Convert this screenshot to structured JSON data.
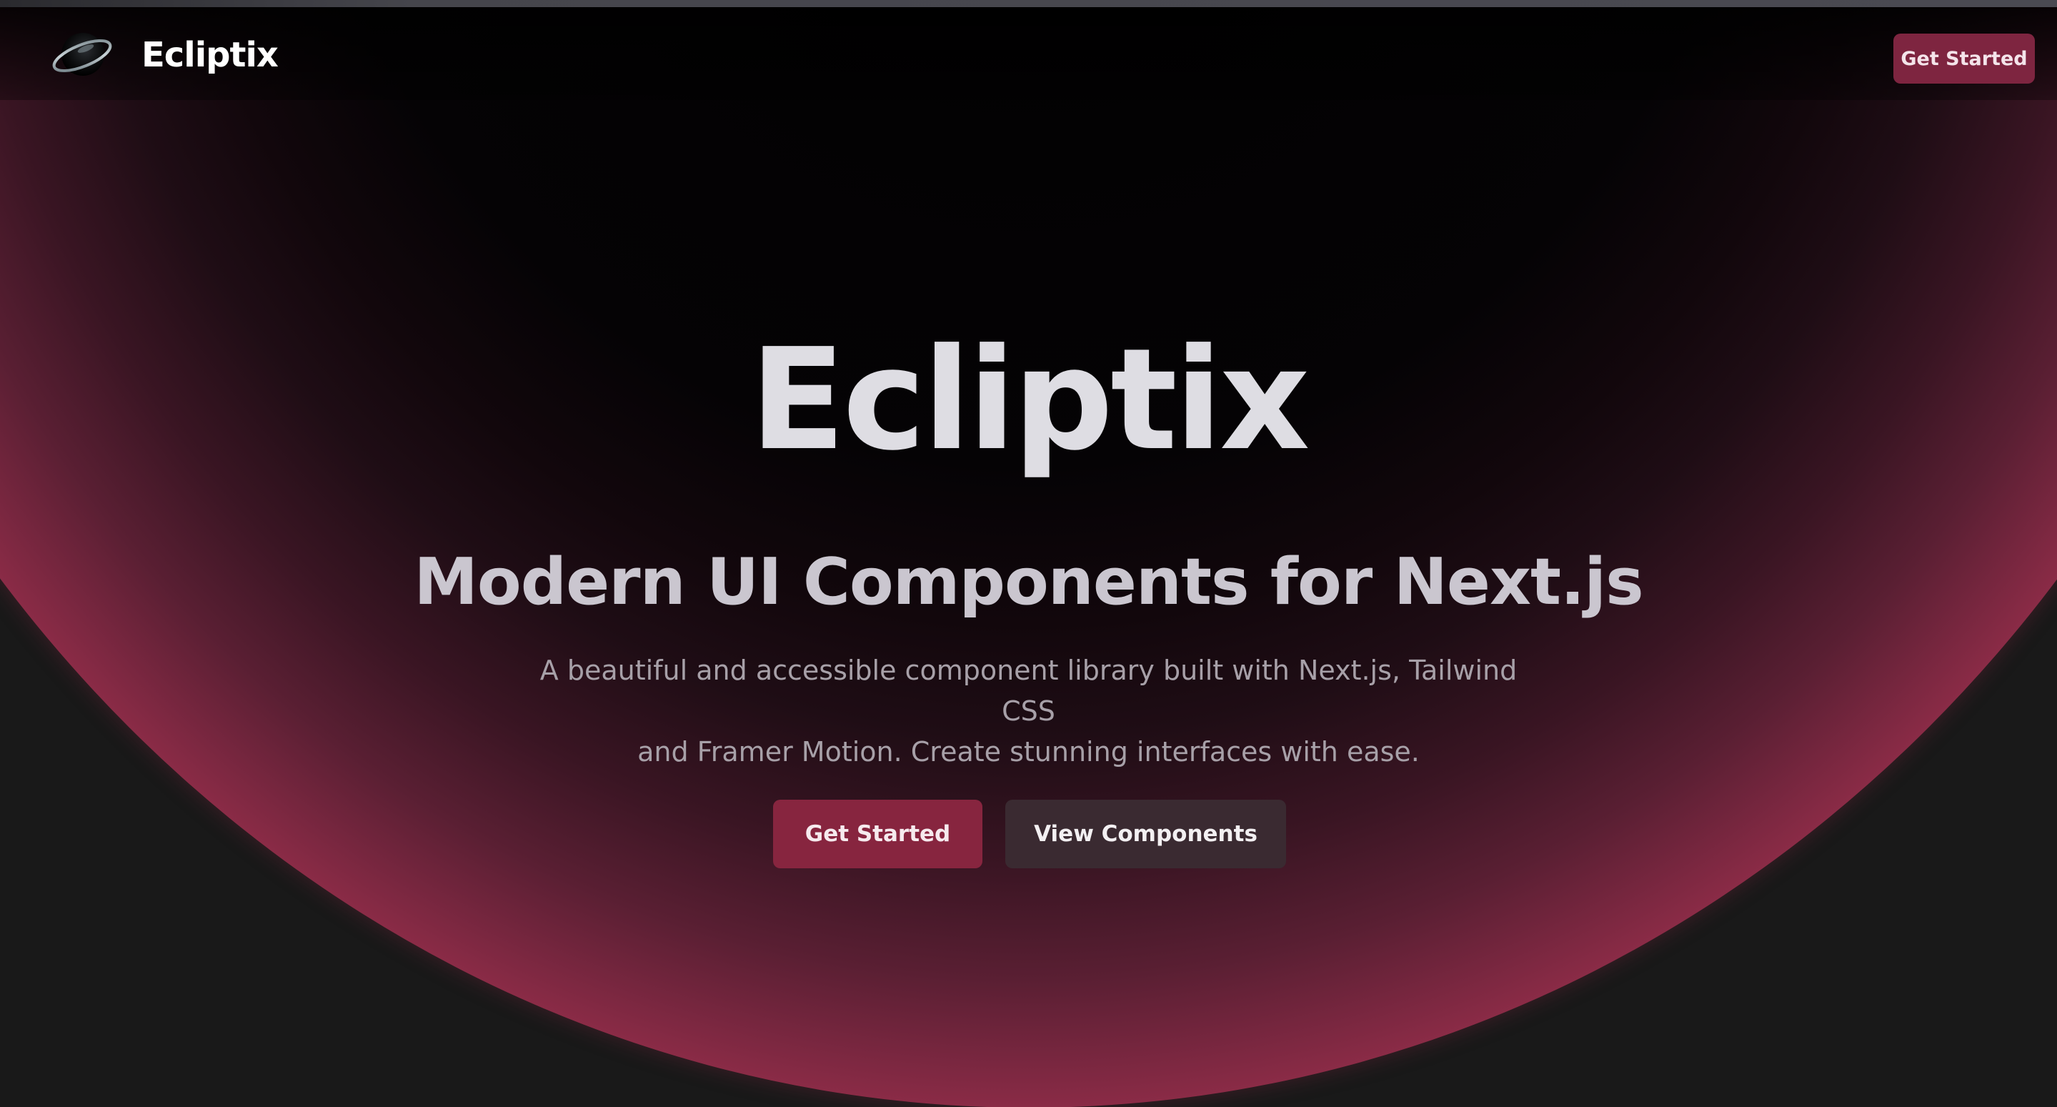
{
  "header": {
    "logo_text": "Ecliptix",
    "logo_icon": "eclipse-ring-icon",
    "cta_label": "Get Started"
  },
  "hero": {
    "title": "Ecliptix",
    "subtitle": "Modern UI Components for Next.js",
    "description_line1": "A beautiful and accessible component library built with Next.js, Tailwind CSS",
    "description_line2": "and Framer Motion. Create stunning interfaces with ease.",
    "primary_button": "Get Started",
    "secondary_button": "View Components"
  },
  "colors": {
    "accent": "#87253f",
    "sphere_rim": "#8a2b46",
    "background": "#191919",
    "secondary_button": "#3a2a31"
  }
}
